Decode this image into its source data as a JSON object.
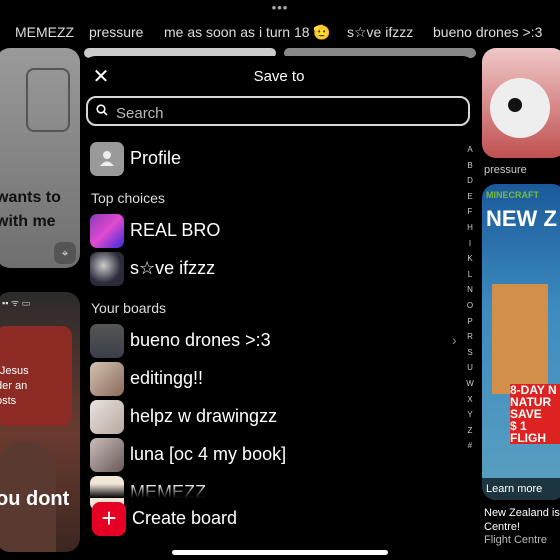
{
  "top_tabs": [
    "MEMEZZ",
    "pressure",
    "me as soon as i turn 18 🫡",
    "s☆ve ifzzz",
    "bueno drones >:3"
  ],
  "background": {
    "pin1_text": "wants to\nwith me",
    "pin2_text": "\"Jesus\nder an\nosts",
    "pin2_bottom": "ou dont",
    "pin5_caption": "pressure",
    "pin6_header": "MINECRAFT",
    "pin6_title": "NEW Z",
    "pin6_badge": "8-DAY N\nNATUR\nSAVE\n$ 1\nFLIGH",
    "pin6_learn_more": "Learn more",
    "pin6_caption": "New Zealand is\nCentre!",
    "pin6_source": "Flight Centre"
  },
  "modal": {
    "title": "Save to",
    "search_placeholder": "Search",
    "profile_label": "Profile",
    "top_choices_label": "Top choices",
    "top_choices": [
      {
        "label": "REAL BRO",
        "color": "#8a3ab9"
      },
      {
        "label": "s☆ve ifzzz",
        "color": "#2b2b3b"
      }
    ],
    "your_boards_label": "Your boards",
    "boards": [
      {
        "label": "bueno drones >:3",
        "color": "#3b3f4a"
      },
      {
        "label": "editingg!!",
        "color": "#d4c2b2"
      },
      {
        "label": "helpz w drawingzz",
        "color": "#e9e3df"
      },
      {
        "label": "luna [oc 4 my book]",
        "color": "#c8bdb8"
      },
      {
        "label": "MEMEZZ",
        "color": "#f0e6d8"
      }
    ],
    "alphabet": [
      "A",
      "B",
      "D",
      "E",
      "F",
      "H",
      "I",
      "K",
      "L",
      "N",
      "O",
      "P",
      "R",
      "S",
      "U",
      "W",
      "X",
      "Y",
      "Z",
      "#"
    ],
    "create_label": "Create board"
  },
  "colors": {
    "accent": "#e60023"
  }
}
